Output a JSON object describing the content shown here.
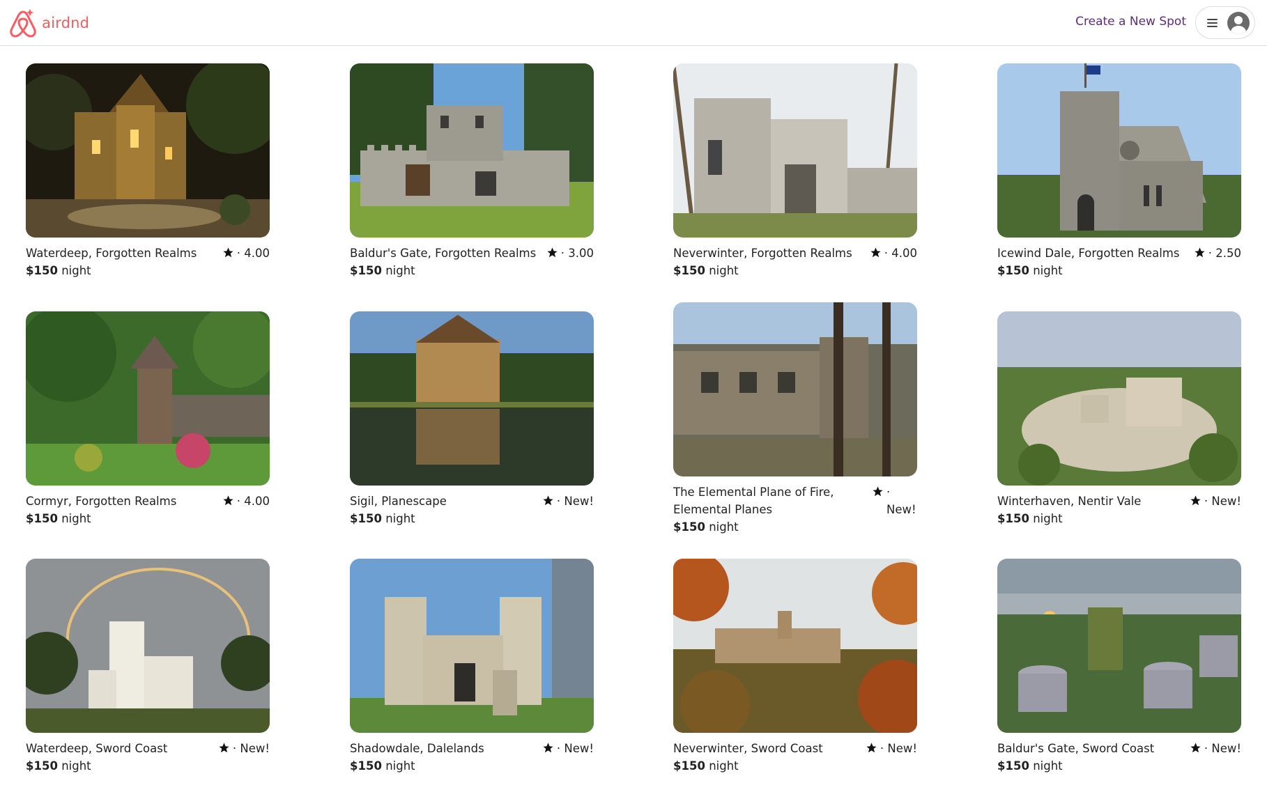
{
  "header": {
    "brand": "airdnd",
    "create_spot": "Create a New Spot"
  },
  "colors": {
    "brand": "#ff5a5f",
    "link": "#5b2d7a"
  },
  "price_unit": "night",
  "spots": [
    {
      "location": "Waterdeep, Forgotten Realms",
      "rating": "· 4.00",
      "price": "$150"
    },
    {
      "location": "Baldur's Gate, Forgotten Realms",
      "rating": "· 3.00",
      "price": "$150"
    },
    {
      "location": "Neverwinter, Forgotten Realms",
      "rating": "· 4.00",
      "price": "$150"
    },
    {
      "location": "Icewind Dale, Forgotten Realms",
      "rating": "· 2.50",
      "price": "$150"
    },
    {
      "location": "Cormyr, Forgotten Realms",
      "rating": "· 4.00",
      "price": "$150"
    },
    {
      "location": "Sigil, Planescape",
      "rating": "· New!",
      "price": "$150"
    },
    {
      "location": "The Elemental Plane of Fire, Elemental Planes",
      "rating": "· New!",
      "price": "$150"
    },
    {
      "location": "Winterhaven, Nentir Vale",
      "rating": "· New!",
      "price": "$150"
    },
    {
      "location": "Waterdeep, Sword Coast",
      "rating": "· New!",
      "price": "$150"
    },
    {
      "location": "Shadowdale, Dalelands",
      "rating": "· New!",
      "price": "$150"
    },
    {
      "location": "Neverwinter, Sword Coast",
      "rating": "· New!",
      "price": "$150"
    },
    {
      "location": "Baldur's Gate, Sword Coast",
      "rating": "· New!",
      "price": "$150"
    }
  ]
}
